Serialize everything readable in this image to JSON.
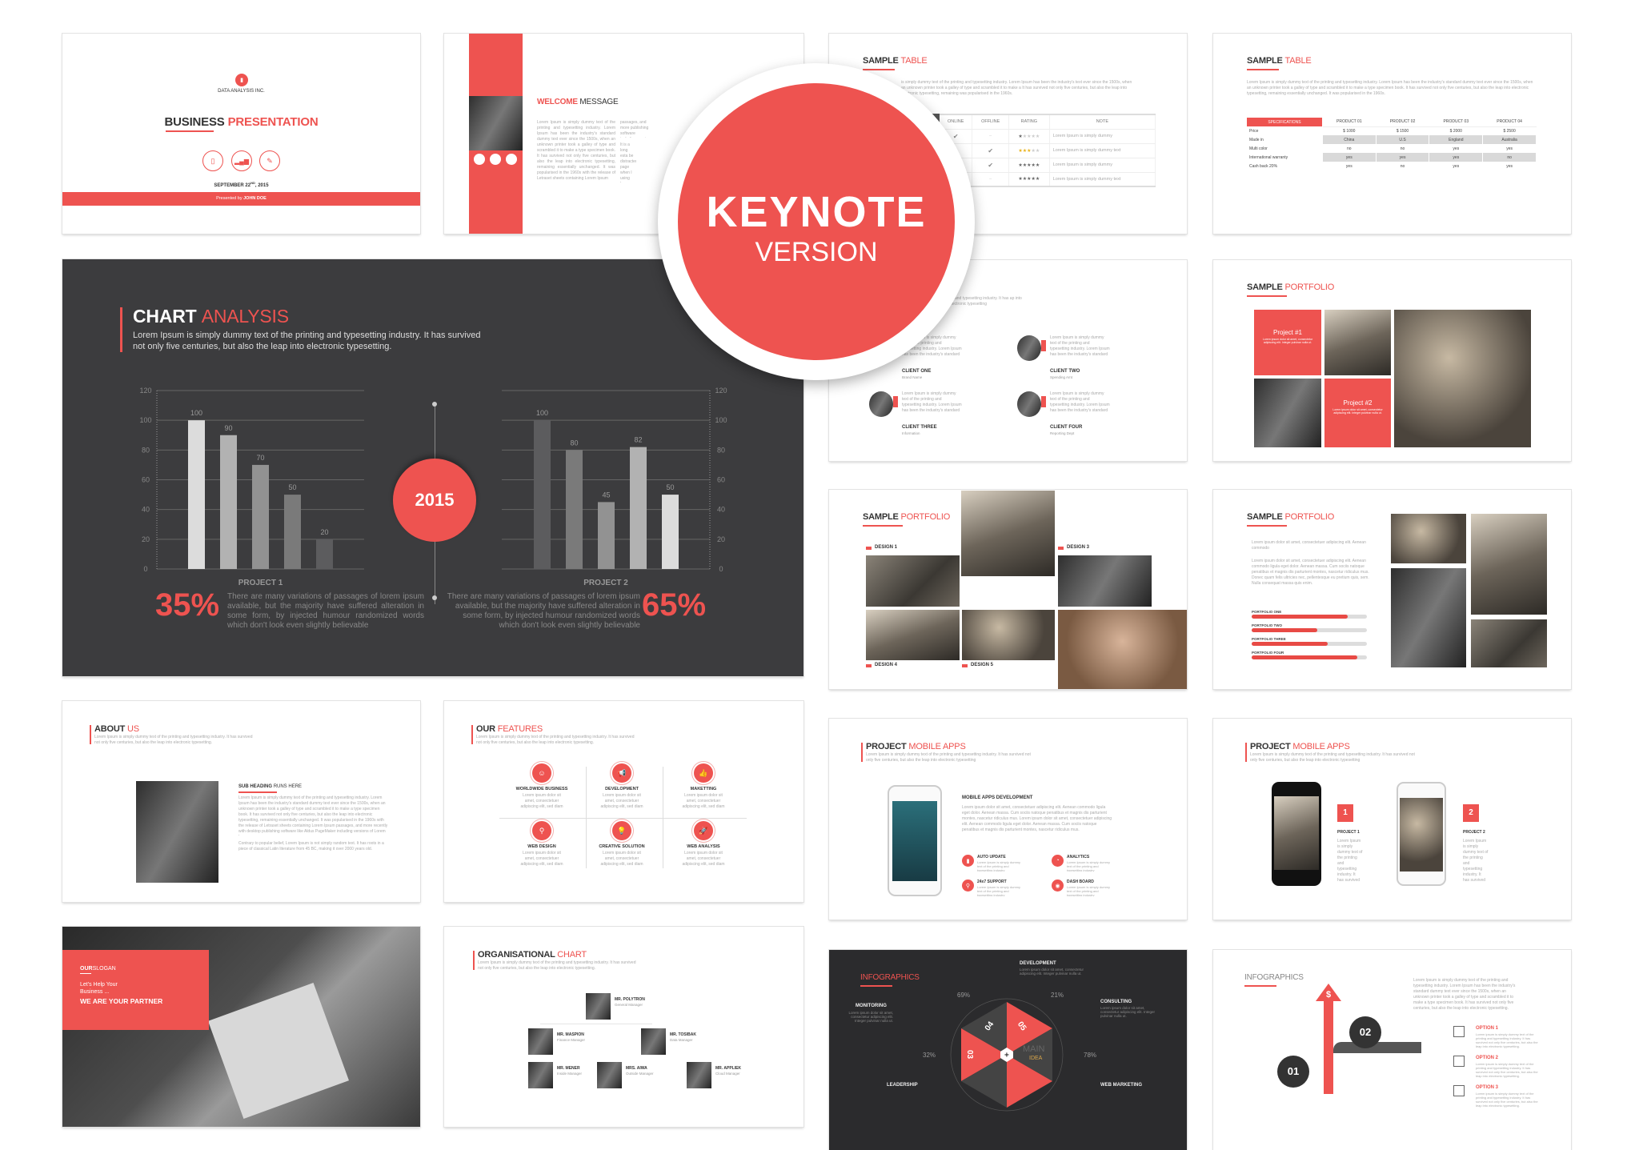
{
  "colors": {
    "accent": "#ee5350",
    "dark_slide": "#3c3c3e",
    "infographic_bg": "#2b2b2d",
    "light_text": "#aaaaaa"
  },
  "badge": {
    "title": "KEYNOTE",
    "subtitle": "VERSION"
  },
  "cover": {
    "company": "DATA ANALYSIS INC.",
    "title_dark": "BUSINESS",
    "title_accent": "PRESENTATION",
    "icons": [
      "document-icon",
      "bar-chart-icon",
      "pencil-ruler-icon"
    ],
    "date_main": "SEPTEMBER 22",
    "date_sup": "ND",
    "date_year": ", 2015",
    "presented_prefix": "Presented by",
    "presenter": "JOHN DOE"
  },
  "welcome": {
    "title_dark": "WELCOME",
    "title_accent": "MESSAGE",
    "col1": "Lorem Ipsum is simply dummy text of the printing and typesetting industry. Lorem Ipsum has been the industry's standard dummy text ever since the 1500s, when an unknown printer took a galley of type and scrambled it to make a type specimen book. It has survived not only five centuries, but also the leap into electronic typesetting, remaining essentially unchanged. It was popularised in the 1960s with the release of Letraset sheets containing Lorem Ipsum",
    "col2": "passages, and more publishing software including versions",
    "col3": "It is a long esta be distracted page when l using Lorer ests mor opposed here', mi"
  },
  "table1": {
    "title_dark": "SAMPLE",
    "title_accent": "TABLE",
    "intro": "is simply dummy text of the printing and typesetting industry. Lorem Ipsum has been the industry's text ever since the 1500s, when an unknown printer took a galley of type and scrambled it to make a It has survived not only five centuries, but also the leap into electronic typesetting, remaining was popularised in the 1960s.",
    "headers": [
      "ONLINE",
      "OFFLINE",
      "RATING",
      "NOTE"
    ],
    "rows": [
      {
        "online": "check",
        "offline": "–",
        "rating": 1,
        "note": "Lorem Ipsum is simply dummy"
      },
      {
        "online": "–",
        "offline": "check",
        "rating": 3,
        "note": "Lorem Ipsum is simply dummy text"
      },
      {
        "online": "–",
        "offline": "check",
        "rating": 5,
        "note": "Lorem Ipsum is simply dummy"
      },
      {
        "online": "–",
        "offline": "–",
        "rating": 5,
        "note": "Lorem Ipsum is simply dummy text"
      }
    ]
  },
  "table2": {
    "title_dark": "SAMPLE",
    "title_accent": "TABLE",
    "intro": "Lorem Ipsum is simply dummy text of the printing and typesetting industry. Lorem Ipsum has been the industry's standard dummy text ever since the 1500s, when an unknown printer took a galley of type and scrambled it to make a type specimen book. It has survived not only five centuries, but also the leap into electronic typesetting, remaining essentially unchanged. It was popularised in the 1960s.",
    "headers": [
      "SPECIFICATIONS",
      "PRODUCT 01",
      "PRODUCT 02",
      "PRODUCT 03",
      "PRODUCT 04"
    ],
    "rows": [
      [
        "Price",
        "$ 1000",
        "$ 1500",
        "$ 2000",
        "$ 2500"
      ],
      [
        "Made in",
        "China",
        "U.S",
        "England",
        "Australia"
      ],
      [
        "Multi color",
        "no",
        "no",
        "yes",
        "yes"
      ],
      [
        "International warranty",
        "yes",
        "yes",
        "yes",
        "no"
      ],
      [
        "Cash back 20%",
        "yes",
        "no",
        "yes",
        "yes"
      ]
    ]
  },
  "chart_slide": {
    "title_dark": "CHART",
    "title_accent": "ANALYSIS",
    "subtitle": "Lorem Ipsum is simply dummy text of the printing and typesetting industry. It has survived not only five centuries, but also the leap into electronic typesetting.",
    "year": "2015",
    "left_pct": "35%",
    "right_pct": "65%",
    "left_text": "There are many variations of passages of lorem ipsum available, but the majority have suffered alteration in some form, by injected humour randomized words which don't look even slightly believable",
    "right_text": "There are many variations of passages of lorem ipsum available, but the majority have suffered alteration in some form, by injected humour randomized words which don't look even slightly believable"
  },
  "chart_data": [
    {
      "type": "bar",
      "title": "",
      "xlabel": "PROJECT 1",
      "ylabel": "",
      "values": [
        100,
        90,
        70,
        50,
        20
      ],
      "ylim": [
        0,
        120
      ],
      "yticks": [
        0,
        20,
        40,
        60,
        80,
        100,
        120
      ],
      "grid": true,
      "axis_side": "left",
      "bar_colors": [
        "#dcdcdc",
        "#b2b2b2",
        "#929292",
        "#7a7a7a",
        "#5c5c5e"
      ]
    },
    {
      "type": "bar",
      "title": "",
      "xlabel": "PROJECT 2",
      "ylabel": "",
      "values": [
        100,
        80,
        45,
        82,
        50
      ],
      "ylim": [
        0,
        120
      ],
      "yticks": [
        0,
        20,
        40,
        60,
        80,
        100,
        120
      ],
      "grid": true,
      "axis_side": "right",
      "bar_colors": [
        "#5c5c5e",
        "#7a7a7a",
        "#929292",
        "#b2b2b2",
        "#dcdcdc"
      ]
    }
  ],
  "clients": {
    "intro": "ng and typesetting industry. It has ap into electronic typesetting",
    "body": "Lorem Ipsum is simply dummy text of the printing and typesetting industry. Lorem Ipsum has been the industry's standard dummy text ever since the 1500s.",
    "items": [
      {
        "name": "CLIENT ONE",
        "role": "Brand Name"
      },
      {
        "name": "CLIENT TWO",
        "role": "Spending Amt"
      },
      {
        "name": "CLIENT THREE",
        "role": "Information"
      },
      {
        "name": "CLIENT FOUR",
        "role": "Reporting Dept"
      }
    ]
  },
  "portfolio1": {
    "title_dark": "SAMPLE",
    "title_accent": "PORTFOLIO",
    "project1": "Project #1",
    "project2": "Project #2",
    "project_text": "Lorem ipsum dolor sit amet, consectetur adipiscing elit. Integer pulvinar nulla ut."
  },
  "portfolio2": {
    "title_dark": "SAMPLE",
    "title_accent": "PORTFOLIO",
    "labels": [
      "DESIGN 1",
      "DESIGN 3",
      "DESIGN 4",
      "DESIGN 5"
    ]
  },
  "portfolio3": {
    "title_dark": "SAMPLE",
    "title_accent": "PORTFOLIO",
    "text1": "Lorem ipsum dolor sit amet, consectetuer adipiscing elit. Aenean commodo",
    "text2": "Lorem ipsum dolor sit amet, consectetuer adipiscing elit. Aenean commodo ligula eget dolor. Aenean massa. Cum sociis natoque penatibus et magnis dis parturient montes, nascetur ridiculus mus. Donec quam felis ultricies nec, pellentesque eu pretium quis, sem. Nulla consequat massa quis enim.",
    "bars": [
      {
        "label": "PORTFOLIO ONE",
        "percent": 83
      },
      {
        "label": "PORTFOLIO TWO",
        "percent": 57
      },
      {
        "label": "PORTFOLIO THREE",
        "percent": 66
      },
      {
        "label": "PORTFOLIO FOUR",
        "percent": 92
      }
    ]
  },
  "mobile1": {
    "title_dark": "PROJECT",
    "title_accent": "MOBILE APPS",
    "intro": "Lorem Ipsum is simply dummy text of the printing and typesetting industry. It has survived not only five centuries, but also the leap into electronic typesetting",
    "heading": "MOBILE APPS DEVELOPMENT",
    "body": "Lorem ipsum dolor sit amet, consectetuer adipiscing elit. Aenean commodo ligula eget dolor. Aenean massa. Cum sociis natoque penatibus et magnis dis parturient montes, nascetur ridiculus mus. Lorem ipsum dolor sit amet, consectetuer adipiscing elit. Aenean commodo ligula eget dolor. Aenean massa. Cum sociis natoque penatibus et magnis dis parturient montes, nascetur ridiculus mus.",
    "features": [
      {
        "name": "AUTO UPDATE",
        "icon": "bar-chart-icon"
      },
      {
        "name": "ANALYTICS",
        "icon": "analytics-icon"
      },
      {
        "name": "24x7 SUPPORT",
        "icon": "location-pin-icon"
      },
      {
        "name": "DASH BOARD",
        "icon": "dashboard-icon"
      }
    ],
    "feature_text": "Lorem Ipsum is simply dummy text of the printing and typesetting industry"
  },
  "mobile2": {
    "title_dark": "PROJECT",
    "title_accent": "MOBILE APPS",
    "intro": "Lorem Ipsum is simply dummy text of the printing and typesetting industry. It has survived not only five centuries, but also the leap into electronic typesetting",
    "projects": [
      {
        "num": "1",
        "name": "PROJECT 1"
      },
      {
        "num": "2",
        "name": "PROJECT 2"
      }
    ],
    "project_text": "Lorem Ipsum is simply dummy text of the printing and typesetting industry. It has survived not only five centuries, but also the leap into electronic typesetting"
  },
  "infographic_dark": {
    "title": "INFOGRAPHICS",
    "labels": {
      "development": "DEVELOPMENT",
      "monitoring": "MONITORING",
      "consulting": "CONSULTING",
      "leadership": "LEADERSHIP",
      "web_marketing": "WEB MARKETING"
    },
    "pcts": [
      "69%",
      "21%",
      "32%",
      "78%"
    ],
    "segments": [
      "04",
      "05",
      "03"
    ],
    "segment_sub": "DATA",
    "main": "MAIN",
    "idea": "IDEA",
    "desc": "Lorem ipsum dolor sit amet, consectetur adipiscing elit. Integer pulvinar nulla ut."
  },
  "infographic_light": {
    "title": "INFOGRAPHICS",
    "intro": "Lorem Ipsum is simply dummy text of the printing and typesetting industry. Lorem Ipsum has been the industry's standard dummy text ever since the 1500s, when an unknown printer took a galley of type and scrambled it to make a type specimen book. It has survived not only five centuries, but also the leap into electronic typesetting.",
    "steps": [
      "01",
      "02"
    ],
    "currency": "$",
    "options": [
      "OPTION 1",
      "OPTION 2",
      "OPTION 3"
    ],
    "option_text": "Lorem ipsum is simply dummy text of the printing and typesetting industry. It has survived not only five centuries, but also the leap into electronic typesetting."
  },
  "about": {
    "title_dark": "ABOUT",
    "title_accent": "US",
    "intro": "Lorem Ipsum is simply dummy text of the printing and typesetting industry. It has survived not only five centuries, but also the leap into electronic typesetting.",
    "sub_dark": "SUB HEADING",
    "sub_light": "RUNS HERE",
    "body": "Lorem Ipsum is simply dummy text of the printing and typesetting industry. Lorem Ipsum has been the industry's standard dummy text ever since the 1500s, when an unknown printer took a galley of type and scrambled it to make a type specimen book. It has survived not only five centuries, but also the leap into electronic typesetting, remaining essentially unchanged. It was popularised in the 1960s with the release of Letraset sheets containing Lorem Ipsum passages, and more recently with desktop publishing software like Aldus PageMaker including versions of Lorem Ipsum.",
    "body2": "Contrary to popular belief, Lorem Ipsum is not simply random text. It has roots in a piece of classical Latin literature from 45 BC, making it over 2000 years old."
  },
  "features": {
    "title_dark": "OUR",
    "title_accent": "FEATURES",
    "intro": "Lorem Ipsum is simply dummy text of the printing and typesetting industry. It has survived not only five centuries, but also the leap into electronic typesetting.",
    "items": [
      {
        "name": "WORLDWIDE BUSINESS",
        "icon": "user-icon"
      },
      {
        "name": "DEVELOPMENT",
        "icon": "megaphone-icon"
      },
      {
        "name": "MAKETTING",
        "icon": "thumbs-up-icon"
      },
      {
        "name": "WEB DESIGN",
        "icon": "search-icon"
      },
      {
        "name": "CREATIVE SOLUTION",
        "icon": "lightbulb-icon"
      },
      {
        "name": "WEB ANALYSIS",
        "icon": "rocket-icon"
      }
    ],
    "item_text": "Lorem ipsum dolor sit amet, consectetuer adipiscing elit, sed diam nonummy"
  },
  "slogan": {
    "title_dark": "OUR",
    "title_light": "SLOGAN",
    "line1": "Let's Help Your",
    "line2": "Business ...",
    "tagline": "WE ARE YOUR PARTNER"
  },
  "org": {
    "title_dark": "ORGANISATIONAL",
    "title_accent": "CHART",
    "intro": "Lorem Ipsum is simply dummy text of the printing and typesetting industry. It has survived not only five centuries, but also the leap into electronic typesetting.",
    "people": [
      {
        "name": "MR. POLYTRON",
        "role": "General Manager"
      },
      {
        "name": "MR. MASPION",
        "role": "Finance Manager"
      },
      {
        "name": "MR. TOSIBAK",
        "role": "Data Manager"
      },
      {
        "name": "MR. MENER",
        "role": "Inside Manager"
      },
      {
        "name": "MRS. AIWA",
        "role": "Outside Manager"
      },
      {
        "name": "MR. APPLIEK",
        "role": "Cloud Manager"
      }
    ]
  }
}
